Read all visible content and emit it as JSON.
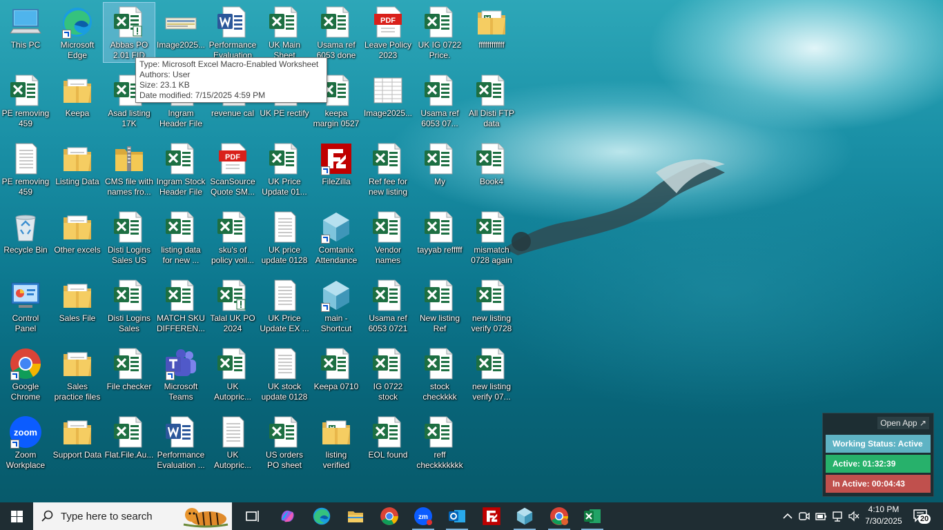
{
  "desktop": {
    "icons": [
      {
        "label": "This PC",
        "type": "pc"
      },
      {
        "label": "Microsoft Edge",
        "type": "edge",
        "shortcut": true
      },
      {
        "label": "Abbas PO 2.01 FID",
        "type": "excel-macro"
      },
      {
        "label": "Image2025...",
        "type": "image-strip"
      },
      {
        "label": "Performance Evaluation",
        "type": "word"
      },
      {
        "label": "UK Main Sheet",
        "type": "excel"
      },
      {
        "label": "Usama ref 6053 done",
        "type": "excel"
      },
      {
        "label": "Leave Policy 2023",
        "type": "pdf"
      },
      {
        "label": "UK IG 0722 Price.",
        "type": "excel"
      },
      {
        "label": "ffffffffffff",
        "type": "folder-excel"
      },
      {
        "label": "PE removing 459",
        "type": "excel"
      },
      {
        "label": "Keepa",
        "type": "folder"
      },
      {
        "label": "Asad listing 17K",
        "type": "excel"
      },
      {
        "label": "Ingram Header File",
        "type": "excel"
      },
      {
        "label": "revenue cal",
        "type": "excel"
      },
      {
        "label": "UK PE rectify",
        "type": "excel"
      },
      {
        "label": "keepa margin 0527",
        "type": "excel"
      },
      {
        "label": "Image2025...",
        "type": "image-sheet"
      },
      {
        "label": "Usama ref 6053 07...",
        "type": "excel"
      },
      {
        "label": "All Disti FTP data",
        "type": "excel"
      },
      {
        "label": "PE removing 459",
        "type": "text"
      },
      {
        "label": "Listing Data",
        "type": "folder"
      },
      {
        "label": "CMS file with names fro...",
        "type": "zip"
      },
      {
        "label": "Ingram Stock Header File",
        "type": "excel"
      },
      {
        "label": "ScanSource Quote SM...",
        "type": "pdf"
      },
      {
        "label": "UK Price Update 01...",
        "type": "excel"
      },
      {
        "label": "FileZilla",
        "type": "filezilla",
        "shortcut": true
      },
      {
        "label": "Ref fee for new listing",
        "type": "excel"
      },
      {
        "label": "My",
        "type": "excel"
      },
      {
        "label": "Book4",
        "type": "excel"
      },
      {
        "label": "Recycle Bin",
        "type": "recycle"
      },
      {
        "label": "Other excels",
        "type": "folder"
      },
      {
        "label": "Disti Logins Sales US",
        "type": "excel"
      },
      {
        "label": "listing data for new ...",
        "type": "excel"
      },
      {
        "label": "sku's of policy voil...",
        "type": "excel"
      },
      {
        "label": "UK price update 0128",
        "type": "text"
      },
      {
        "label": "Comtanix Attendance",
        "type": "comtanix",
        "shortcut": true
      },
      {
        "label": "Vendor names",
        "type": "excel"
      },
      {
        "label": "tayyab refffff",
        "type": "excel"
      },
      {
        "label": "mismatch 0728 again",
        "type": "excel"
      },
      {
        "label": "Control Panel",
        "type": "control"
      },
      {
        "label": "Sales File",
        "type": "folder"
      },
      {
        "label": "Disti Logins Sales",
        "type": "excel"
      },
      {
        "label": "MATCH SKU DIFFEREN...",
        "type": "excel"
      },
      {
        "label": "Talal UK PO 2024",
        "type": "excel-macro"
      },
      {
        "label": "UK Price Update EX ...",
        "type": "text"
      },
      {
        "label": "main - Shortcut",
        "type": "comtanix",
        "shortcut": true
      },
      {
        "label": "Usama ref 6053 0721",
        "type": "excel"
      },
      {
        "label": "New listing Ref",
        "type": "excel"
      },
      {
        "label": "new listing verify 0728",
        "type": "excel"
      },
      {
        "label": "Google Chrome",
        "type": "chrome",
        "shortcut": true
      },
      {
        "label": "Sales practice files",
        "type": "folder"
      },
      {
        "label": "File checker",
        "type": "excel"
      },
      {
        "label": "Microsoft Teams",
        "type": "teams",
        "shortcut": true
      },
      {
        "label": "UK Autopric...",
        "type": "excel"
      },
      {
        "label": "UK stock update 0128",
        "type": "text"
      },
      {
        "label": "Keepa 0710",
        "type": "excel"
      },
      {
        "label": "IG 0722 stock",
        "type": "excel"
      },
      {
        "label": "stock checkkkk",
        "type": "excel"
      },
      {
        "label": "new listing verify 07...",
        "type": "excel"
      },
      {
        "label": "Zoom Workplace",
        "type": "zoom",
        "shortcut": true
      },
      {
        "label": "Support Data",
        "type": "folder"
      },
      {
        "label": "Flat.File.Au...",
        "type": "excel"
      },
      {
        "label": "Performance Evaluation ...",
        "type": "word"
      },
      {
        "label": "UK Autopric...",
        "type": "text"
      },
      {
        "label": "US orders PO sheet",
        "type": "excel"
      },
      {
        "label": "listing verified",
        "type": "folder-excel"
      },
      {
        "label": "EOL found",
        "type": "excel"
      },
      {
        "label": "reff checkkkkkkk",
        "type": "excel"
      }
    ],
    "tooltip": {
      "type": "Type: Microsoft Excel Macro-Enabled Worksheet",
      "authors": "Authors: User",
      "size": "Size: 23.1 KB",
      "modified": "Date modified: 7/15/2025 4:59 PM"
    }
  },
  "tracker": {
    "open_app": "Open App ↗",
    "status": "Working Status: Active",
    "active": "Active: 01:32:39",
    "inactive": "In Active: 00:04:43",
    "colors": {
      "status": "#5fb3c4",
      "active": "#27b16b",
      "inactive": "#c0504d"
    }
  },
  "taskbar": {
    "search_placeholder": "Type here to search",
    "apps": [
      "task-view",
      "copilot",
      "edge",
      "file-explorer",
      "chrome",
      "zoom",
      "outlook",
      "filezilla",
      "comtanix",
      "chrome-profile",
      "excel"
    ],
    "time": "4:10 PM",
    "date": "7/30/2025",
    "notifications": "20"
  }
}
